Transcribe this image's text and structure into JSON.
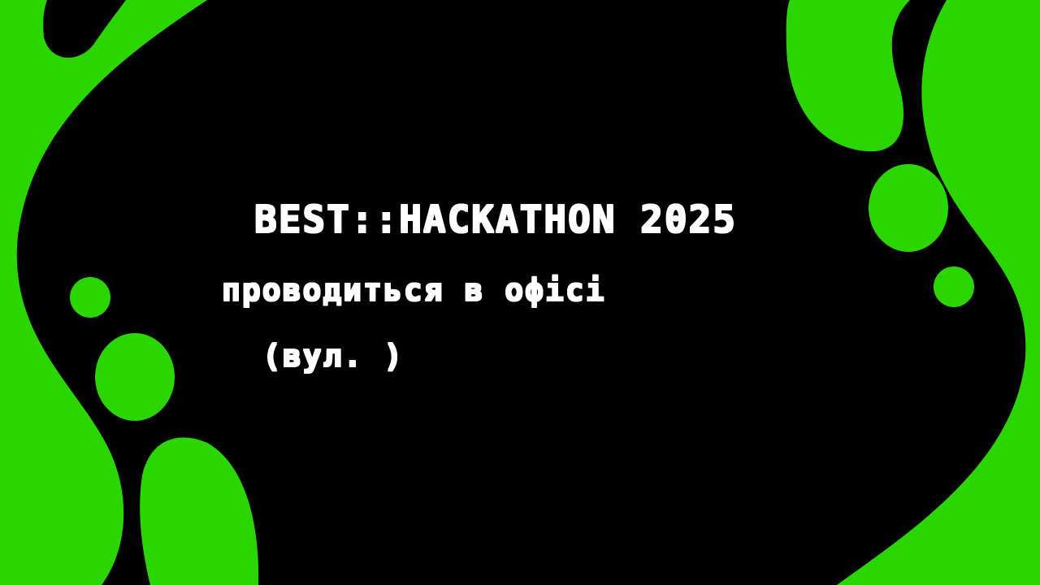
{
  "slide": {
    "title": "BEST::HACKATHON 2025",
    "subtitle": "проводиться в офісі",
    "address": "(вул. )"
  },
  "colors": {
    "background": "#000000",
    "accent_green": "#2BD600",
    "text": "#FFFFFF"
  }
}
